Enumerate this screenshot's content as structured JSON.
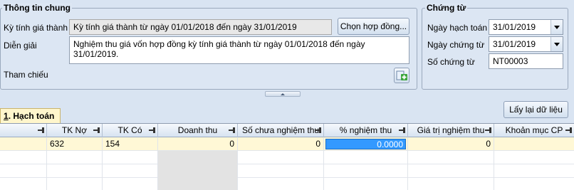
{
  "general": {
    "title": "Thông tin chung",
    "period_label": "Kỳ tính giá thành",
    "period_value": "Kỳ tính giá thành từ ngày 01/01/2018 đến ngày 31/01/2019",
    "choose_contract_label": "Chọn hợp đồng...",
    "description_label": "Diễn giải",
    "description_value": "Nghiệm thu giá vốn hợp đồng kỳ tính giá thành từ ngày 01/01/2018 đến ngày 31/01/2019.",
    "reference_label": "Tham chiếu",
    "add_reference_icon": "add-plus-icon"
  },
  "voucher": {
    "title": "Chứng từ",
    "posting_date_label": "Ngày hạch toán",
    "posting_date_value": "31/01/2019",
    "voucher_date_label": "Ngày chứng từ",
    "voucher_date_value": "31/01/2019",
    "voucher_no_label": "Số chứng từ",
    "voucher_no_value": "NT00003"
  },
  "tab": {
    "number": "1",
    "label": ". Hạch toán"
  },
  "reload_button_label": "Lấy lại dữ liệu",
  "grid": {
    "columns": [
      "TK Nợ",
      "TK Có",
      "Doanh thu",
      "Số chưa nghiệm thu",
      "% nghiệm thu",
      "Giá trị nghiệm thu",
      "Khoản mục CP"
    ],
    "rows": [
      {
        "debit": "632",
        "credit": "154",
        "revenue": "0",
        "not_accepted": "0",
        "percent": "0.0000",
        "accepted_value": "0",
        "cost_item": ""
      }
    ]
  }
}
